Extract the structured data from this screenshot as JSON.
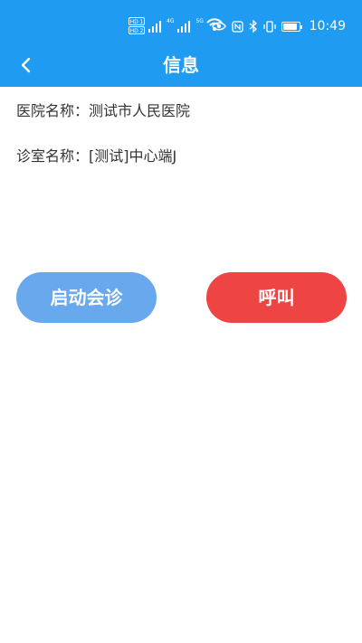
{
  "status_bar": {
    "hd1": "HD 1",
    "hd2": "HD 2",
    "network1": "4G",
    "network2": "5G",
    "time": "10:49",
    "battery_level": 0.9,
    "icons": [
      "eye-icon",
      "nfc-icon",
      "bluetooth-icon",
      "vibrate-icon",
      "battery-icon"
    ]
  },
  "nav": {
    "title": "信息",
    "back_icon": "chevron-left-icon"
  },
  "info": {
    "hospital_label": "医院名称：",
    "hospital_value": "测试市人民医院",
    "clinic_label": "诊室名称：",
    "clinic_value": "[测试]中心端J"
  },
  "actions": {
    "start_consultation": "启动会诊",
    "call": "呼叫"
  },
  "colors": {
    "primary": "#1f9bf2",
    "consult_button": "#68a8ec",
    "call_button": "#ee4444",
    "text": "#333333"
  }
}
